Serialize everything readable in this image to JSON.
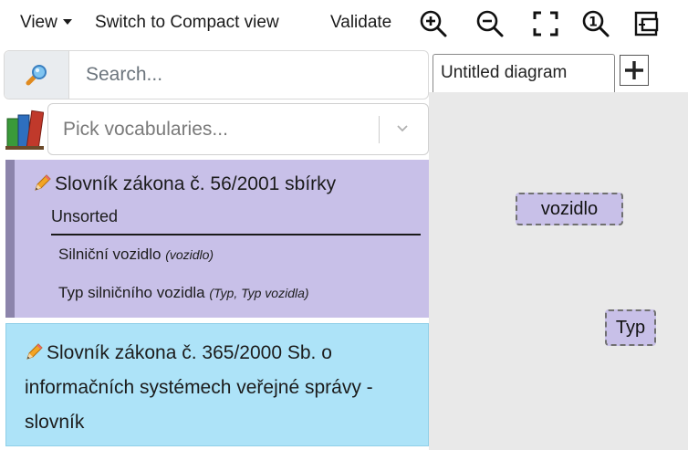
{
  "toolbar": {
    "view_label": "View",
    "compact_label": "Switch to Compact view",
    "validate_label": "Validate",
    "icons": [
      "zoom-in-icon",
      "zoom-out-icon",
      "fit-screen-icon",
      "zoom-reset-icon",
      "center-view-icon"
    ],
    "zoom_reset_digit": "1"
  },
  "search": {
    "placeholder": "Search...",
    "value": ""
  },
  "vocab_picker": {
    "placeholder": "Pick vocabularies..."
  },
  "vocabularies": [
    {
      "title": "Slovník zákona č. 56/2001 sbírky",
      "color": "#c8c0e8",
      "group": "Unsorted",
      "terms": [
        {
          "label": "Silniční vozidlo",
          "alt": "(vozidlo)"
        },
        {
          "label": "Typ silničního vozidla",
          "alt": "(Typ, Typ vozidla)"
        }
      ]
    },
    {
      "title": "Slovník zákona č. 365/2000 Sb. o informačních systémech veřejné správy - slovník",
      "color": "#ade3f8"
    }
  ],
  "diagram": {
    "tab_label": "Untitled diagram",
    "nodes": [
      {
        "label": "vozidlo"
      },
      {
        "label": "Typ"
      }
    ]
  },
  "colors": {
    "canvas": "#e9e9e9",
    "node_fill": "#c8c0e8",
    "card1_stripe": "#8c84ab",
    "card2_fill": "#ade3f8"
  }
}
